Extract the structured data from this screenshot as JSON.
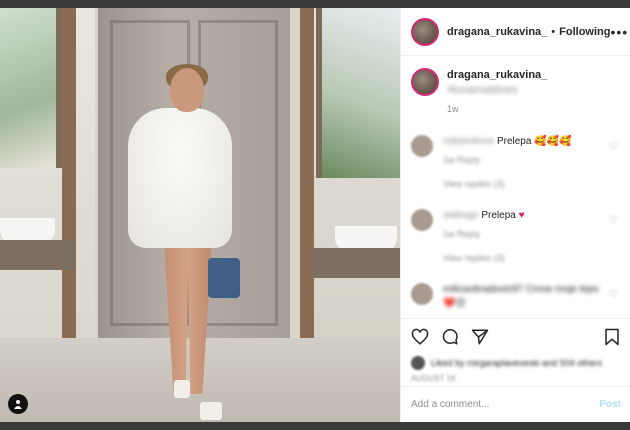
{
  "header": {
    "username": "dragana_rukavina_",
    "separator": "•",
    "follow_status": "Following",
    "more_icon": "more-horizontal-icon"
  },
  "caption": {
    "username": "dragana_rukavina_",
    "text": "#lunamaldives",
    "time": "1w"
  },
  "comments": [
    {
      "username": "cobelutinne",
      "text": "Prelepa",
      "meta": "1w   Reply",
      "replies": "View replies (3)"
    },
    {
      "username": "stabogo",
      "text": "Prelepa",
      "meta": "1w   Reply",
      "replies": "View replies (3)"
    },
    {
      "username": "milicaobradovic97",
      "text": "Cmoe moje lepo",
      "meta": "",
      "replies": ""
    }
  ],
  "likes": {
    "text": "Liked by mirgaraplaveveski and 504 others"
  },
  "posted": {
    "text": "AUGUST 19"
  },
  "add_comment": {
    "placeholder": "Add a comment...",
    "post_label": "Post"
  },
  "icons": {
    "like": "heart-icon",
    "comment": "comment-icon",
    "share": "paper-plane-icon",
    "save": "bookmark-icon",
    "user_tag": "user-tag-icon"
  },
  "colors": {
    "avatar_ring": "#d62976",
    "post_button": "#b2dffc",
    "text": "#262626",
    "muted": "#8e8e8e"
  }
}
